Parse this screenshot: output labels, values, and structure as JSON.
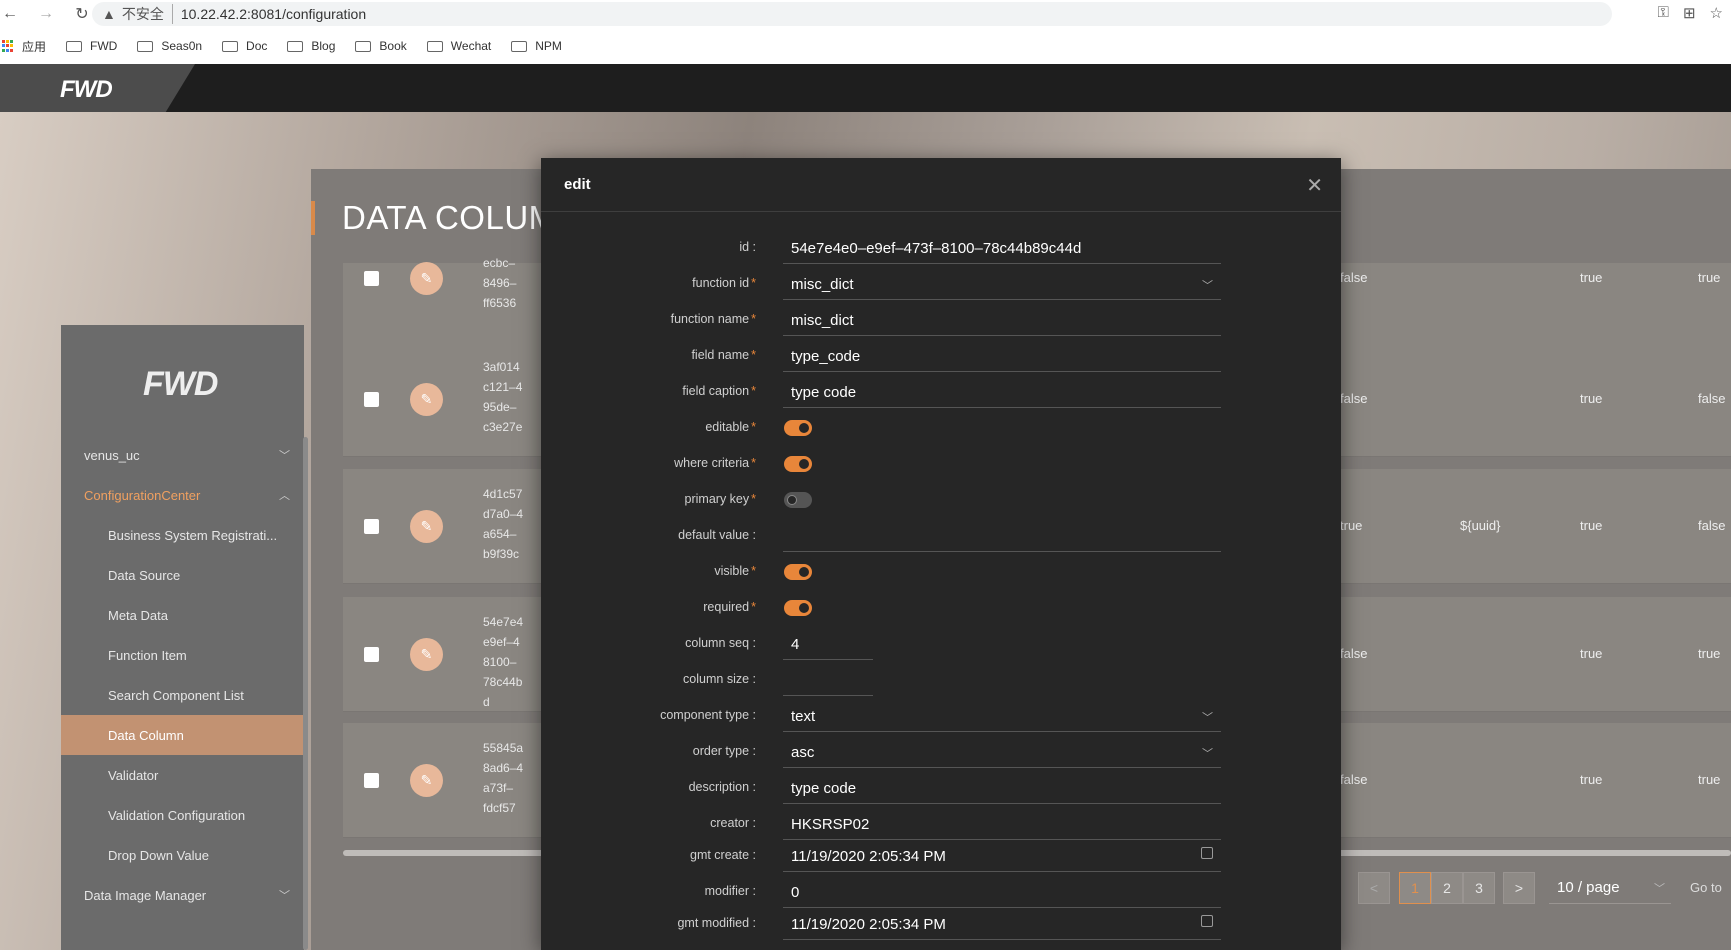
{
  "browser": {
    "url": "10.22.42.2:8081/configuration",
    "insecure_label": "不安全",
    "bookmarks": [
      {
        "label": "应用",
        "icon": "apps-grid-icon"
      },
      {
        "label": "FWD",
        "icon": "folder-icon"
      },
      {
        "label": "Seas0n",
        "icon": "folder-icon"
      },
      {
        "label": "Doc",
        "icon": "folder-icon"
      },
      {
        "label": "Blog",
        "icon": "folder-icon"
      },
      {
        "label": "Book",
        "icon": "folder-icon"
      },
      {
        "label": "Wechat",
        "icon": "folder-icon"
      },
      {
        "label": "NPM",
        "icon": "folder-icon"
      }
    ]
  },
  "header": {
    "logo": "FWD"
  },
  "sidebar": {
    "logo": "FWD",
    "items": [
      {
        "label": "venus_uc",
        "level": 1,
        "chevron": "down"
      },
      {
        "label": "ConfigurationCenter",
        "level": 1,
        "chevron": "up"
      },
      {
        "label": "Business System Registrati...",
        "level": 2
      },
      {
        "label": "Data Source",
        "level": 2
      },
      {
        "label": "Meta Data",
        "level": 2
      },
      {
        "label": "Function Item",
        "level": 2
      },
      {
        "label": "Search Component List",
        "level": 2
      },
      {
        "label": "Data Column",
        "level": 2,
        "active": true
      },
      {
        "label": "Validator",
        "level": 2
      },
      {
        "label": "Validation Configuration",
        "level": 2
      },
      {
        "label": "Drop Down Value",
        "level": 2
      },
      {
        "label": "Data Image Manager",
        "level": 1,
        "chevron": "down"
      }
    ]
  },
  "page": {
    "title": "DATA COLUM",
    "rows": [
      {
        "id_lines": [
          "ecbc–",
          "8496–",
          "ff6536"
        ],
        "c1": "false",
        "c2": "",
        "c3": "true",
        "c4": "true"
      },
      {
        "id_lines": [
          "3af014",
          "c121–4",
          "95de–",
          "c3e27e"
        ],
        "c1": "false",
        "c2": "",
        "c3": "true",
        "c4": "false"
      },
      {
        "id_lines": [
          "4d1c57",
          "d7a0–4",
          "a654–",
          "b9f39c"
        ],
        "c1": "true",
        "c2": "${uuid}",
        "c3": "true",
        "c4": "false"
      },
      {
        "id_lines": [
          "54e7e4",
          "e9ef–4",
          "8100–",
          "78c44b",
          "d"
        ],
        "c1": "false",
        "c2": "",
        "c3": "true",
        "c4": "true"
      },
      {
        "id_lines": [
          "55845a",
          "8ad6–4",
          "a73f–",
          "fdcf57"
        ],
        "c1": "false",
        "c2": "",
        "c3": "true",
        "c4": "true"
      }
    ],
    "pagination": {
      "prev": "<",
      "pages": [
        "1",
        "2",
        "3"
      ],
      "current": "1",
      "next": ">",
      "page_size": "10 / page",
      "goto": "Go to"
    }
  },
  "modal": {
    "title": "edit",
    "fields": [
      {
        "label": "id :",
        "value": "54e7e4e0–e9ef–473f–8100–78c44b89c44d",
        "type": "text"
      },
      {
        "label": "function id",
        "required": true,
        "value": "misc_dict",
        "type": "select"
      },
      {
        "label": "function name",
        "required": true,
        "value": "misc_dict",
        "type": "text"
      },
      {
        "label": "field name",
        "required": true,
        "value": "type_code",
        "type": "text"
      },
      {
        "label": "field caption",
        "required": true,
        "value": "type code",
        "type": "text"
      },
      {
        "label": "editable",
        "required": true,
        "value": true,
        "type": "switch"
      },
      {
        "label": "where criteria",
        "required": true,
        "value": true,
        "type": "switch"
      },
      {
        "label": "primary key",
        "required": true,
        "value": false,
        "type": "switch"
      },
      {
        "label": "default value :",
        "value": "",
        "type": "text"
      },
      {
        "label": "visible",
        "required": true,
        "value": true,
        "type": "switch"
      },
      {
        "label": "required",
        "required": true,
        "value": true,
        "type": "switch"
      },
      {
        "label": "column seq :",
        "value": "4",
        "type": "number"
      },
      {
        "label": "column size :",
        "value": "",
        "type": "number"
      },
      {
        "label": "component type :",
        "value": "text",
        "type": "select"
      },
      {
        "label": "order type :",
        "value": "asc",
        "type": "select"
      },
      {
        "label": "description :",
        "value": "type code",
        "type": "text"
      },
      {
        "label": "creator :",
        "value": "HKSRSP02",
        "type": "text"
      },
      {
        "label": "gmt create :",
        "value": "11/19/2020 2:05:34 PM",
        "type": "date"
      },
      {
        "label": "modifier :",
        "value": "0",
        "type": "text"
      },
      {
        "label": "gmt modified :",
        "value": "11/19/2020 2:05:34 PM",
        "type": "date"
      }
    ]
  },
  "colors": {
    "accent": "#e8863a",
    "modal_bg": "#262626",
    "topbar": "#1e1e1e"
  }
}
